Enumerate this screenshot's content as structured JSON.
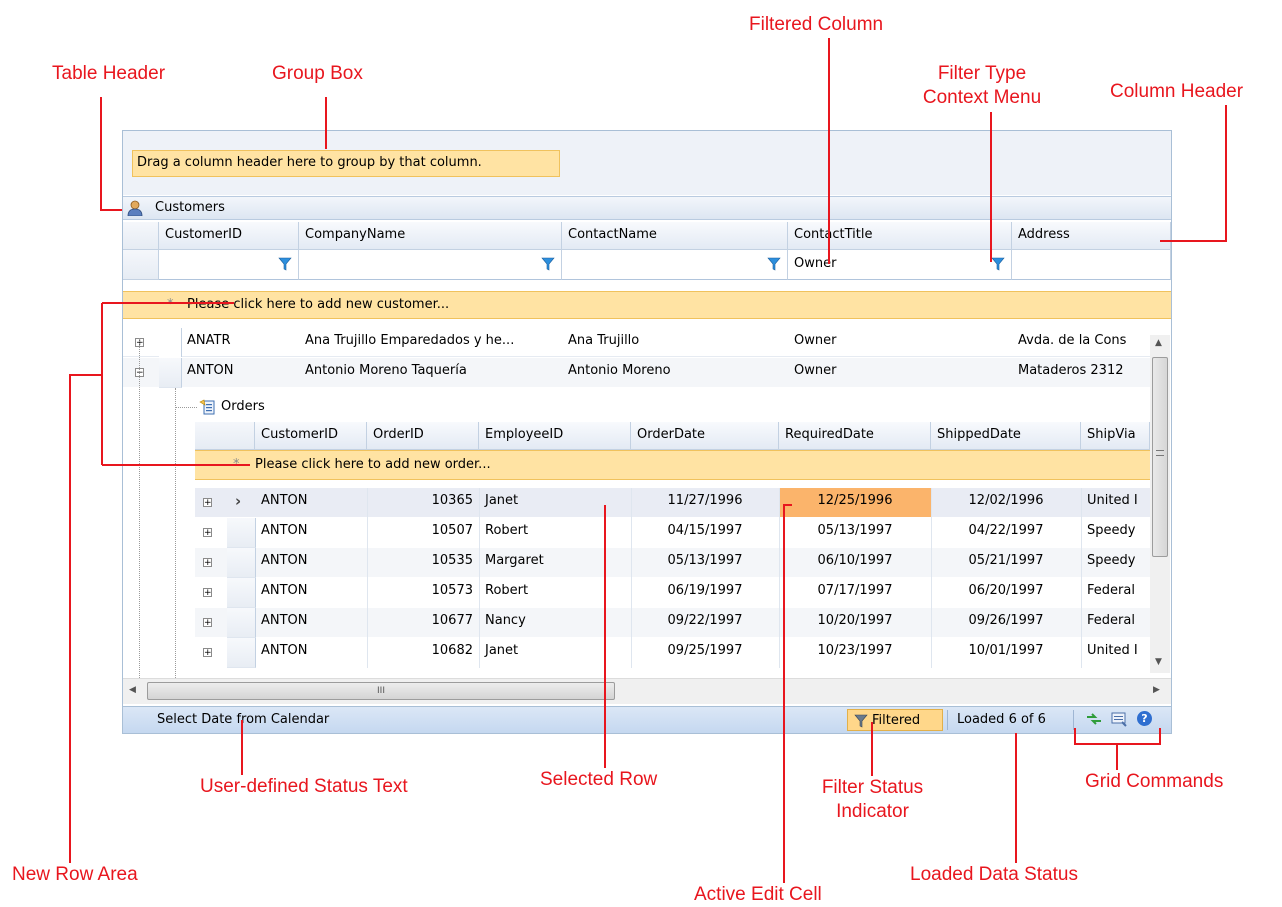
{
  "callouts": {
    "table_header": "Table Header",
    "group_box": "Group  Box",
    "filtered_column": "Filtered Column",
    "filter_type_1": "Filter Type",
    "filter_type_2": "Context Menu",
    "column_header": "Column Header",
    "user_status": "User-defined Status Text",
    "selected_row": "Selected Row",
    "filter_status_1": "Filter Status",
    "filter_status_2": "Indicator",
    "grid_commands": "Grid Commands",
    "new_row_area": "New Row Area",
    "active_edit_cell": "Active Edit Cell",
    "loaded_status": "Loaded Data Status"
  },
  "grid": {
    "group_prompt": "Drag a column header here to group by that column.",
    "table_title": "Customers",
    "columns": [
      "CustomerID",
      "CompanyName",
      "ContactName",
      "ContactTitle",
      "Address"
    ],
    "filter_value": "Owner",
    "new_row_text": "Please click here to add new customer...",
    "rows": [
      {
        "CustomerID": "ANATR",
        "CompanyName": "Ana Trujillo Emparedados y he...",
        "ContactName": "Ana Trujillo",
        "ContactTitle": "Owner",
        "Address": "Avda. de la Cons"
      },
      {
        "CustomerID": "ANTON",
        "CompanyName": "Antonio Moreno Taquería",
        "ContactName": "Antonio Moreno",
        "ContactTitle": "Owner",
        "Address": "Mataderos 2312"
      }
    ],
    "child": {
      "title": "Orders",
      "columns": [
        "CustomerID",
        "OrderID",
        "EmployeeID",
        "OrderDate",
        "RequiredDate",
        "ShippedDate",
        "ShipVia"
      ],
      "new_row_text": "Please click here to add new order...",
      "rows": [
        {
          "CustomerID": "ANTON",
          "OrderID": "10365",
          "EmployeeID": "Janet",
          "OrderDate": "11/27/1996",
          "RequiredDate": "12/25/1996",
          "ShippedDate": "12/02/1996",
          "ShipVia": "United I"
        },
        {
          "CustomerID": "ANTON",
          "OrderID": "10507",
          "EmployeeID": "Robert",
          "OrderDate": "04/15/1997",
          "RequiredDate": "05/13/1997",
          "ShippedDate": "04/22/1997",
          "ShipVia": "Speedy"
        },
        {
          "CustomerID": "ANTON",
          "OrderID": "10535",
          "EmployeeID": "Margaret",
          "OrderDate": "05/13/1997",
          "RequiredDate": "06/10/1997",
          "ShippedDate": "05/21/1997",
          "ShipVia": "Speedy"
        },
        {
          "CustomerID": "ANTON",
          "OrderID": "10573",
          "EmployeeID": "Robert",
          "OrderDate": "06/19/1997",
          "RequiredDate": "07/17/1997",
          "ShippedDate": "06/20/1997",
          "ShipVia": "Federal"
        },
        {
          "CustomerID": "ANTON",
          "OrderID": "10677",
          "EmployeeID": "Nancy",
          "OrderDate": "09/22/1997",
          "RequiredDate": "10/20/1997",
          "ShippedDate": "09/26/1997",
          "ShipVia": "Federal"
        },
        {
          "CustomerID": "ANTON",
          "OrderID": "10682",
          "EmployeeID": "Janet",
          "OrderDate": "09/25/1997",
          "RequiredDate": "10/23/1997",
          "ShippedDate": "10/01/1997",
          "ShipVia": "United I"
        }
      ]
    },
    "status_text": "Select Date from Calendar",
    "filtered_label": "Filtered",
    "loaded_text": "Loaded 6 of 6",
    "hscroll_grip": "III",
    "colors": {
      "accent": "#e8161e",
      "new_row": "#ffe3a3",
      "active_cell": "#fbb46b",
      "status_bar": "#c5d8f0"
    }
  }
}
